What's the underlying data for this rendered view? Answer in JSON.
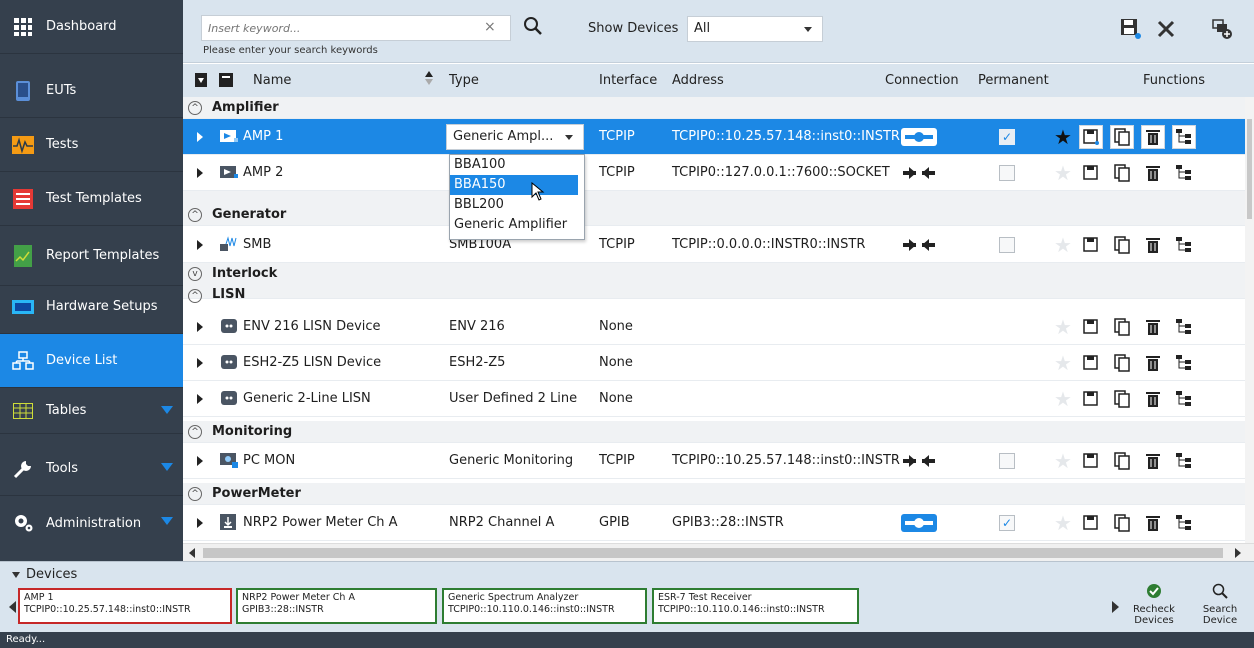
{
  "sidebar": {
    "items": [
      {
        "label": "Dashboard",
        "icon": "dashboard-icon"
      },
      {
        "label": "EUTs",
        "icon": "eut-icon"
      },
      {
        "label": "Tests",
        "icon": "tests-icon"
      },
      {
        "label": "Test Templates",
        "icon": "test-templates-icon"
      },
      {
        "label": "Report Templates",
        "icon": "report-templates-icon"
      },
      {
        "label": "Hardware Setups",
        "icon": "hardware-setups-icon"
      },
      {
        "label": "Device List",
        "icon": "device-list-icon",
        "active": true
      },
      {
        "label": "Tables",
        "icon": "tables-icon"
      },
      {
        "label": "Tools",
        "icon": "tools-icon"
      },
      {
        "label": "Administration",
        "icon": "gear-icon"
      }
    ]
  },
  "toolbar": {
    "search_placeholder": "Insert keyword...",
    "search_hint": "Please enter your search keywords",
    "clear_glyph": "×",
    "show_devices_label": "Show Devices",
    "show_devices_value": "All"
  },
  "columns": {
    "name": "Name",
    "type": "Type",
    "interface": "Interface",
    "address": "Address",
    "connection": "Connection",
    "permanent": "Permanent",
    "functions": "Functions"
  },
  "groups": {
    "amplifier": "Amplifier",
    "generator": "Generator",
    "interlock": "Interlock",
    "lisn": "LISN",
    "monitoring": "Monitoring",
    "powermeter": "PowerMeter"
  },
  "rows": {
    "amp1": {
      "name": "AMP 1",
      "type": "Generic Ampl...",
      "interface": "TCPIP",
      "address": "TCPIP0::10.25.57.148::inst0::INSTR",
      "permanent": true,
      "connected": true
    },
    "amp2": {
      "name": "AMP 2",
      "type": "",
      "interface": "TCPIP",
      "address": "TCPIP0::127.0.0.1::7600::SOCKET",
      "permanent": false,
      "connected": false
    },
    "smb": {
      "name": "SMB",
      "type": "SMB100A",
      "interface": "TCPIP",
      "address": "TCPIP::0.0.0.0::INSTR0::INSTR",
      "permanent": false,
      "connected": false
    },
    "env216": {
      "name": "ENV 216 LISN Device",
      "type": "ENV 216",
      "interface": "None",
      "address": ""
    },
    "esh2z5": {
      "name": "ESH2-Z5 LISN Device",
      "type": "ESH2-Z5",
      "interface": "None",
      "address": ""
    },
    "generic2": {
      "name": "Generic 2-Line LISN",
      "type": "User Defined 2 Line",
      "interface": "None",
      "address": ""
    },
    "pcmon": {
      "name": "PC MON",
      "type": "Generic Monitoring",
      "interface": "TCPIP",
      "address": "TCPIP0::10.25.57.148::inst0::INSTR",
      "permanent": false,
      "connected": false
    },
    "nrp2": {
      "name": "NRP2 Power Meter Ch A",
      "type": "NRP2 Channel A",
      "interface": "GPIB",
      "address": "GPIB3::28::INSTR",
      "permanent": true,
      "connected": true
    }
  },
  "type_dropdown": {
    "options": [
      "BBA100",
      "BBA150",
      "BBL200",
      "Generic Amplifier"
    ],
    "highlighted": "BBA150"
  },
  "devices_panel": {
    "title": "Devices",
    "cards": [
      {
        "name": "AMP 1",
        "address": "TCPIP0::10.25.57.148::inst0::INSTR",
        "status": "red"
      },
      {
        "name": "NRP2 Power Meter Ch A",
        "address": "GPIB3::28::INSTR",
        "status": "green"
      },
      {
        "name": "Generic Spectrum Analyzer",
        "address": "TCPIP0::10.110.0.146::inst0::INSTR",
        "status": "green"
      },
      {
        "name": "ESR-7 Test Receiver",
        "address": "TCPIP0::10.110.0.146::inst0::INSTR",
        "status": "green"
      }
    ],
    "recheck_line1": "Recheck",
    "recheck_line2": "Devices",
    "search_line1": "Search",
    "search_line2": "Device"
  },
  "status": "Ready...",
  "colors": {
    "accent": "#1c88e5",
    "sidebar": "#35404d",
    "toolbar": "#d9e4ee",
    "ok": "#2e7d32",
    "error": "#c62828"
  }
}
